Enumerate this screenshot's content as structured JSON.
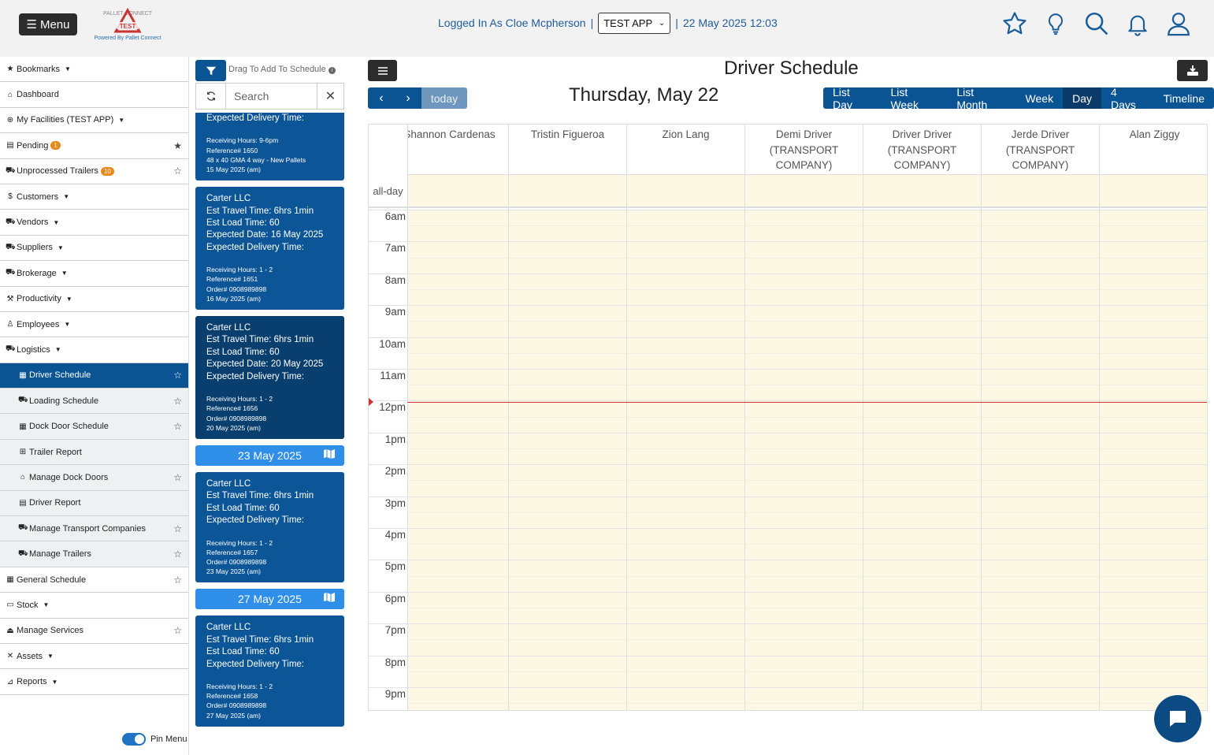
{
  "header": {
    "menu_label": "Menu",
    "logo_text": "TEST",
    "logo_top_text": "PALLET CONNECT",
    "powered_by": "Powered By Pallet Connect",
    "logged_in_text": "Logged In As Cloe Mcpherson",
    "separator": "|",
    "app_select_value": "TEST APP",
    "datetime": "22 May 2025 12:03",
    "icons": [
      "star-icon",
      "lightbulb-icon",
      "search-icon",
      "bell-icon",
      "user-icon"
    ]
  },
  "sidebar": {
    "items": [
      {
        "label": "Bookmarks",
        "icon": "star-icon"
      },
      {
        "label": "Dashboard",
        "icon": "home-icon"
      },
      {
        "label": "My Facilities (TEST APP)",
        "icon": "globe-icon"
      },
      {
        "label": "Pending",
        "icon": "clipboard-icon",
        "badge": "1"
      },
      {
        "label": "Unprocessed Trailers",
        "icon": "trailer-icon",
        "badge": "10"
      },
      {
        "label": "Customers",
        "icon": "dollar-icon"
      },
      {
        "label": "Vendors",
        "icon": "truck-icon"
      },
      {
        "label": "Suppliers",
        "icon": "truck-icon"
      },
      {
        "label": "Brokerage",
        "icon": "truck-icon"
      },
      {
        "label": "Productivity",
        "icon": "hammer-icon"
      },
      {
        "label": "Employees",
        "icon": "person-icon"
      },
      {
        "label": "Logistics",
        "icon": "truck-icon"
      },
      {
        "label": "Driver Schedule",
        "icon": "calendar-icon"
      },
      {
        "label": "Loading Schedule",
        "icon": "forklift-icon"
      },
      {
        "label": "Dock Door Schedule",
        "icon": "calendar-icon"
      },
      {
        "label": "Trailer Report",
        "icon": "table-icon"
      },
      {
        "label": "Manage Dock Doors",
        "icon": "warehouse-icon"
      },
      {
        "label": "Driver Report",
        "icon": "report-icon"
      },
      {
        "label": "Manage Transport Companies",
        "icon": "truck-icon"
      },
      {
        "label": "Manage Trailers",
        "icon": "trailer-icon"
      },
      {
        "label": "General Schedule",
        "icon": "calendar-icon"
      },
      {
        "label": "Stock",
        "icon": "pallet-icon"
      },
      {
        "label": "Manage Services",
        "icon": "services-icon"
      },
      {
        "label": "Assets",
        "icon": "tools-icon"
      },
      {
        "label": "Reports",
        "icon": "chart-icon"
      }
    ],
    "pin_menu_label": "Pin Menu"
  },
  "drag_panel": {
    "hint": "Drag To Add To Schedule",
    "search_placeholder": "Search",
    "partial_card": {
      "line": "Expected Delivery Time:",
      "receiving": "Receiving Hours: 9-6pm",
      "reference": "Reference# 1650",
      "product": "48 x 40 GMA 4 way - New Pallets",
      "date": "15 May 2025 (am)"
    },
    "cards": [
      {
        "customer": "Carter LLC",
        "travel": "Est Travel Time: 6hrs 1min",
        "load": "Est Load Time: 60",
        "expected_date": "Expected Date: 16 May 2025",
        "delivery": "Expected Delivery Time:",
        "receiving": "Receiving Hours: 1 - 2",
        "reference": "Reference# 1651",
        "order": "Order# 0908989898",
        "date": "16 May 2025 (am)"
      },
      {
        "customer": "Carter LLC",
        "travel": "Est Travel Time: 6hrs 1min",
        "load": "Est Load Time: 60",
        "expected_date": "Expected Date: 20 May 2025",
        "delivery": "Expected Delivery Time:",
        "receiving": "Receiving Hours: 1 - 2",
        "reference": "Reference# 1656",
        "order": "Order# 0908989898",
        "date": "20 May 2025 (am)"
      }
    ],
    "group_23": {
      "header": "23 May 2025",
      "card": {
        "customer": "Carter LLC",
        "travel": "Est Travel Time: 6hrs 1min",
        "load": "Est Load Time: 60",
        "delivery": "Expected Delivery Time:",
        "receiving": "Receiving Hours: 1 - 2",
        "reference": "Reference# 1657",
        "order": "Order# 0908989898",
        "date": "23 May 2025 (am)"
      }
    },
    "group_27": {
      "header": "27 May 2025",
      "card": {
        "customer": "Carter LLC",
        "travel": "Est Travel Time: 6hrs 1min",
        "load": "Est Load Time: 60",
        "delivery": "Expected Delivery Time:",
        "receiving": "Receiving Hours: 1 - 2",
        "reference": "Reference# 1658",
        "order": "Order# 0908989898",
        "date": "27 May 2025 (am)"
      }
    }
  },
  "calendar": {
    "title": "Driver Schedule",
    "date_label": "Thursday, May 22",
    "today_label": "today",
    "views": [
      "List Day",
      "List Week",
      "List Month",
      "Week",
      "Day",
      "4 Days",
      "Timeline"
    ],
    "active_view": "Day",
    "resources": [
      {
        "line1": "Shannon Cardenas",
        "line2": "",
        "line3": ""
      },
      {
        "line1": "Tristin Figueroa",
        "line2": "",
        "line3": ""
      },
      {
        "line1": "Zion Lang",
        "line2": "",
        "line3": ""
      },
      {
        "line1": "Demi Driver",
        "line2": "(TRANSPORT",
        "line3": "COMPANY)"
      },
      {
        "line1": "Driver Driver",
        "line2": "(TRANSPORT",
        "line3": "COMPANY)"
      },
      {
        "line1": "Jerde Driver",
        "line2": "(TRANSPORT",
        "line3": "COMPANY)"
      },
      {
        "line1": "Alan Ziggy",
        "line2": "",
        "line3": ""
      }
    ],
    "allday_label": "all-day",
    "hours": [
      "6am",
      "7am",
      "8am",
      "9am",
      "10am",
      "11am",
      "12pm",
      "1pm",
      "2pm",
      "3pm",
      "4pm",
      "5pm",
      "6pm",
      "7pm",
      "8pm",
      "9pm"
    ],
    "today_color": "#fcf8e3",
    "now_indicator_color": "#d03030",
    "accent_color": "#0b5494"
  }
}
